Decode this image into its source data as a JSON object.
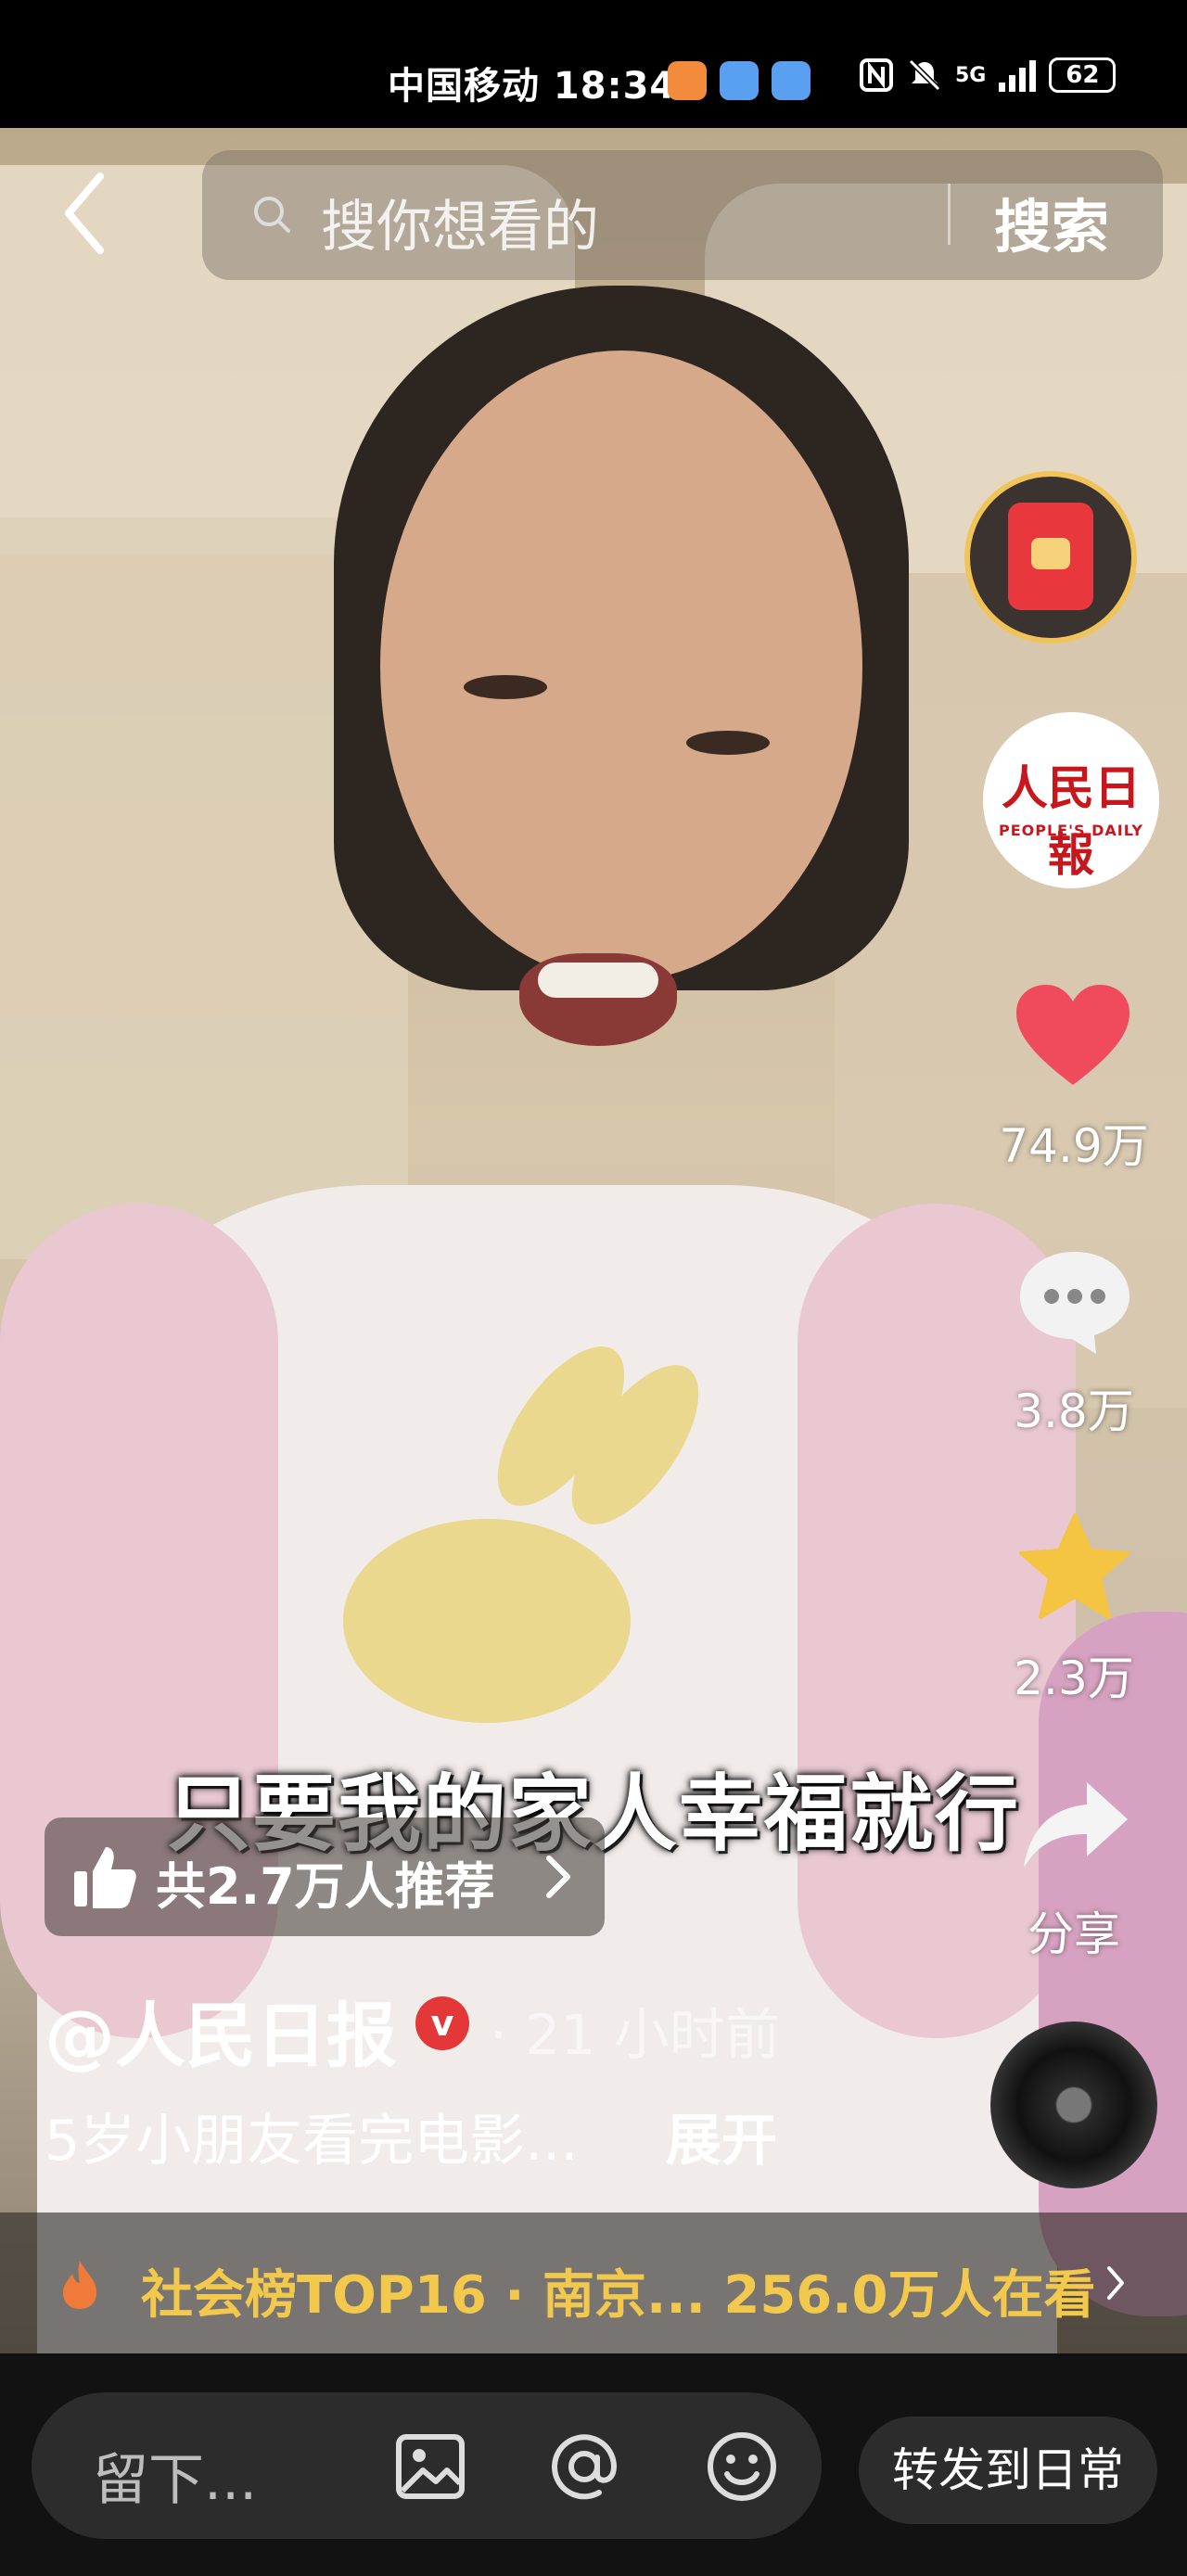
{
  "status_bar": {
    "carrier_time": "中国移动 18:34",
    "network": "5G",
    "battery": "62"
  },
  "search": {
    "placeholder": "搜你想看的",
    "button_label": "搜索"
  },
  "video": {
    "caption": "只要我的家人幸福就行"
  },
  "rail": {
    "likes": "74.9万",
    "comments": "3.8万",
    "favorites": "2.3万",
    "share": "分享",
    "avatar_logo": "人民日報",
    "avatar_sub": "PEOPLE'S DAILY"
  },
  "recommend": {
    "text": "共2.7万人推荐"
  },
  "post": {
    "author": "@人民日报",
    "verified_mark": "v",
    "time_ago": "· 21 小时前",
    "description": "5岁小朋友看完电影...",
    "expand_label": "展开"
  },
  "trending": {
    "text": "社会榜TOP16 · 南京...   256.0万人在看"
  },
  "bottom_bar": {
    "comment_placeholder": "留下...",
    "share_daily_label": "转发到日常"
  },
  "colors": {
    "accent_yellow": "#f2c94c",
    "like_red": "#ef4b5c",
    "star_yellow": "#f6c443",
    "verified_red": "#e43737"
  }
}
